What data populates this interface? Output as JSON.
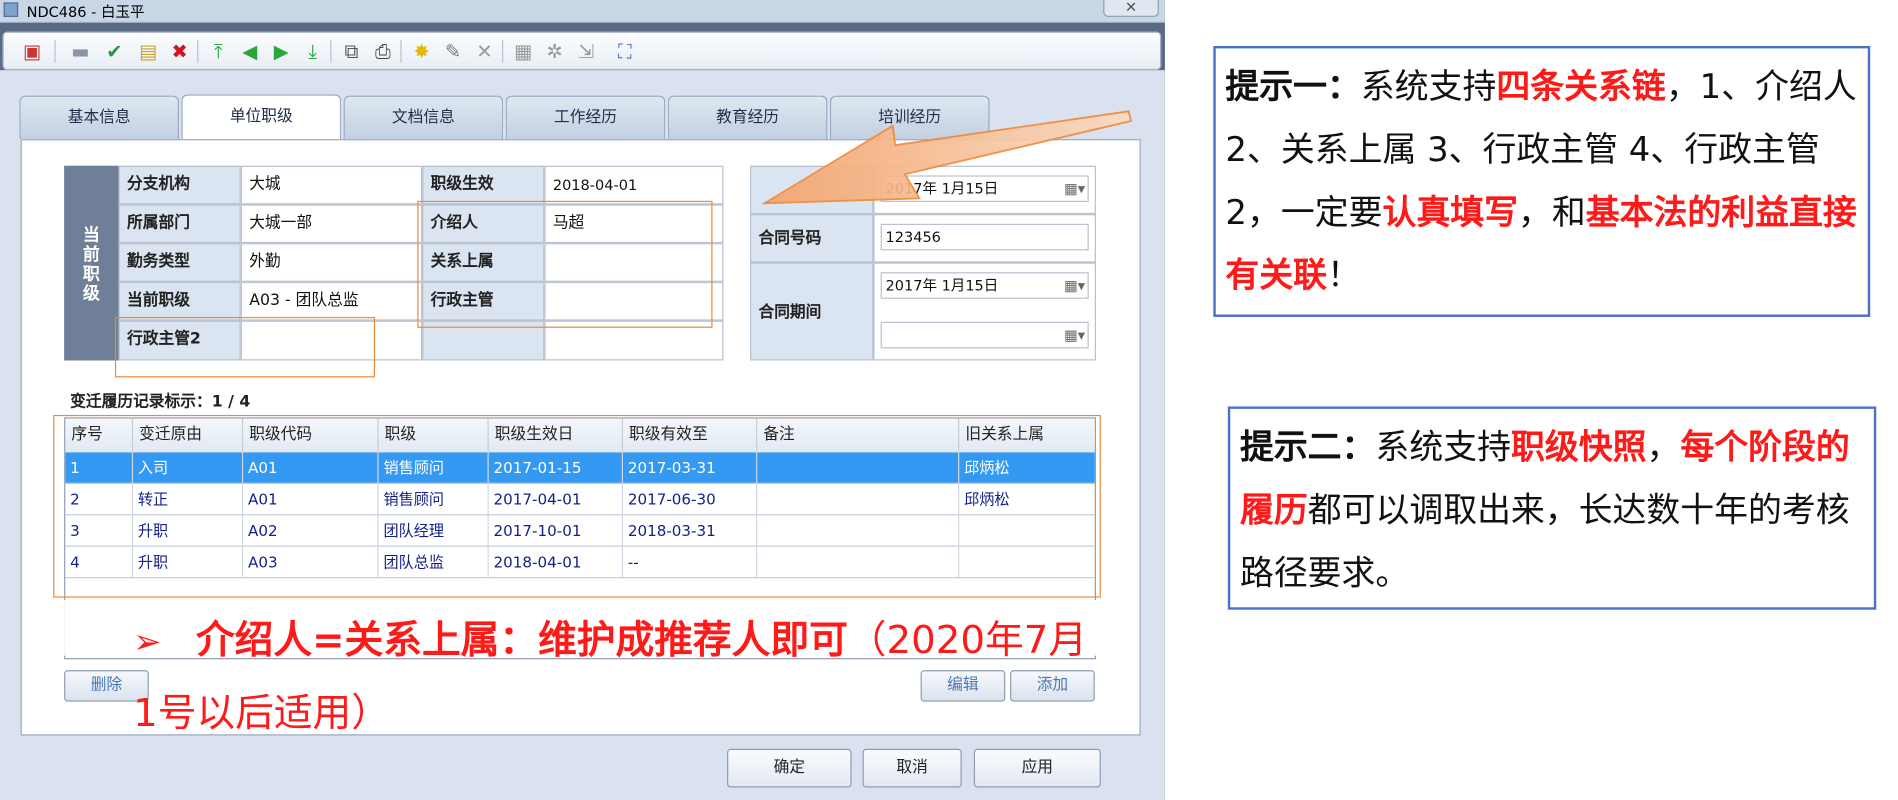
{
  "window": {
    "title": "NDC486 - 白玉平",
    "close_glyph": "✕"
  },
  "toolbar_icons": [
    "record-icon",
    "save-icon",
    "confirm-icon",
    "card-icon",
    "delete-icon",
    "first-icon",
    "prev-icon",
    "next-icon",
    "last-icon",
    "copy-icon",
    "print-icon",
    "star-icon",
    "wrench-icon",
    "cross-icon",
    "grid-icon",
    "gear-icon",
    "export-icon",
    "expand-icon"
  ],
  "tabs": [
    {
      "label": "基本信息"
    },
    {
      "label": "单位职级"
    },
    {
      "label": "文档信息"
    },
    {
      "label": "工作经历"
    },
    {
      "label": "教育经历"
    },
    {
      "label": "培训经历"
    }
  ],
  "active_tab": "单位职级",
  "side_header": "当前职级",
  "form": {
    "branch_label": "分支机构",
    "branch_value": "大城",
    "dept_label": "所属部门",
    "dept_value": "大城一部",
    "duty_label": "勤务类型",
    "duty_value": "外勤",
    "rank_label": "当前职级",
    "rank_value": "A03 - 团队总监",
    "admin2_label": "行政主管2",
    "admin2_value": "",
    "effective_label": "职级生效",
    "effective_value": "2018-04-01",
    "introducer_label": "介绍人",
    "introducer_value": "马超",
    "superior_label": "关系上属",
    "superior_value": "",
    "admin_label": "行政主管",
    "admin_value": ""
  },
  "contract": {
    "date_value": "2017年  1月15日",
    "no_label": "合同号码",
    "no_value": "123456",
    "period_label": "合同期间",
    "period_start": "2017年  1月15日",
    "period_end": ""
  },
  "history": {
    "caption": "变迁履历记录标示：1 / 4",
    "headers": [
      "序号",
      "变迁原由",
      "职级代码",
      "职级",
      "职级生效日",
      "职级有效至",
      "备注",
      "旧关系上属"
    ],
    "rows": [
      [
        "1",
        "入司",
        "A01",
        "销售顾问",
        "2017-01-15",
        "2017-03-31",
        "",
        "邱炳松"
      ],
      [
        "2",
        "转正",
        "A01",
        "销售顾问",
        "2017-04-01",
        "2017-06-30",
        "",
        "邱炳松"
      ],
      [
        "3",
        "升职",
        "A02",
        "团队经理",
        "2017-10-01",
        "2018-03-31",
        "",
        ""
      ],
      [
        "4",
        "升职",
        "A03",
        "团队总监",
        "2018-04-01",
        "--",
        "",
        ""
      ]
    ],
    "selected_row": 1
  },
  "buttons": {
    "delete": "删除",
    "edit": "编辑",
    "add": "添加",
    "ok": "确定",
    "cancel": "取消",
    "apply": "应用"
  },
  "note": {
    "arrow": "➢",
    "bold": "介绍人=关系上属：维护成推荐人即可",
    "tail": "（2020年7月1号以后适用）"
  },
  "tip1": {
    "title": "提示一：",
    "t1": "系统支持",
    "h1": "四条关系链",
    "t2": "，1、介绍人 2、关系上属 3、行政主管 4、行政主管2，一定要",
    "h2": "认真填写",
    "t3": "，和",
    "h3": "基本法的利益直接有关联",
    "t4": "！"
  },
  "tip2": {
    "title": "提示二：",
    "t1": "系统支持",
    "h1": "职级快照",
    "t2": "，",
    "h2": "每个阶段的履历",
    "t3": "都可以调取出来，长达数十年的考核路径要求。"
  },
  "colors": {
    "accent_red": "#ff1a1a",
    "highlight_orange": "#ee8a3a",
    "selection_blue": "#3399f3",
    "tip_border": "#4a72c4"
  }
}
